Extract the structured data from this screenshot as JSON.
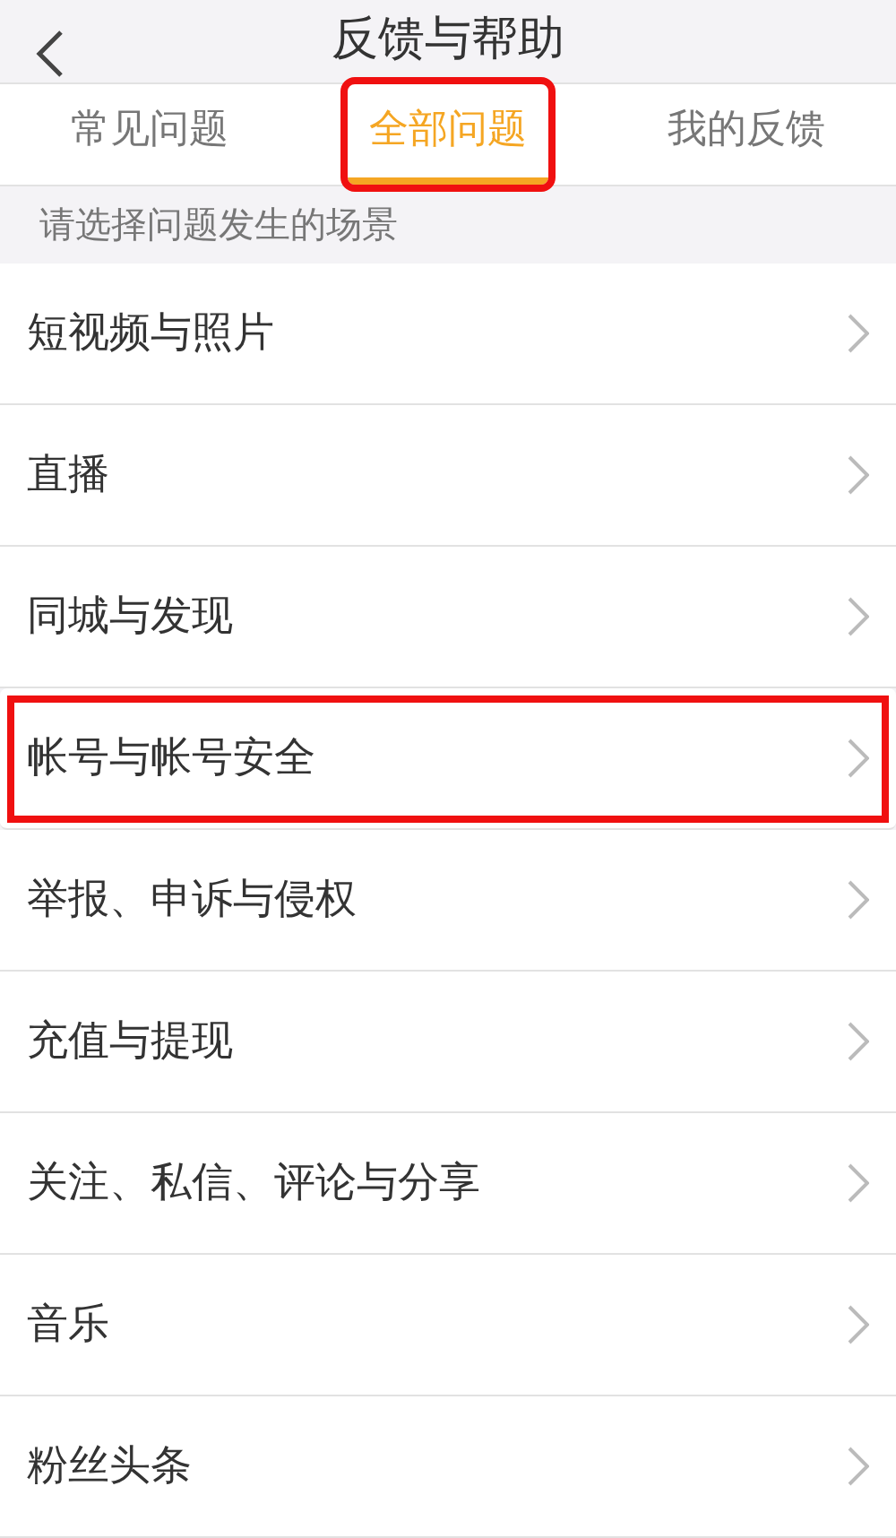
{
  "header": {
    "title": "反馈与帮助"
  },
  "tabs": [
    {
      "label": "常见问题",
      "selected": false,
      "highlighted": false
    },
    {
      "label": "全部问题",
      "selected": true,
      "highlighted": true
    },
    {
      "label": "我的反馈",
      "selected": false,
      "highlighted": false
    }
  ],
  "section_hint": "请选择问题发生的场景",
  "items": [
    {
      "label": "短视频与照片",
      "highlighted": false
    },
    {
      "label": "直播",
      "highlighted": false
    },
    {
      "label": "同城与发现",
      "highlighted": false
    },
    {
      "label": "帐号与帐号安全",
      "highlighted": true
    },
    {
      "label": "举报、申诉与侵权",
      "highlighted": false
    },
    {
      "label": "充值与提现",
      "highlighted": false
    },
    {
      "label": "关注、私信、评论与分享",
      "highlighted": false
    },
    {
      "label": "音乐",
      "highlighted": false
    },
    {
      "label": "粉丝头条",
      "highlighted": false
    }
  ]
}
